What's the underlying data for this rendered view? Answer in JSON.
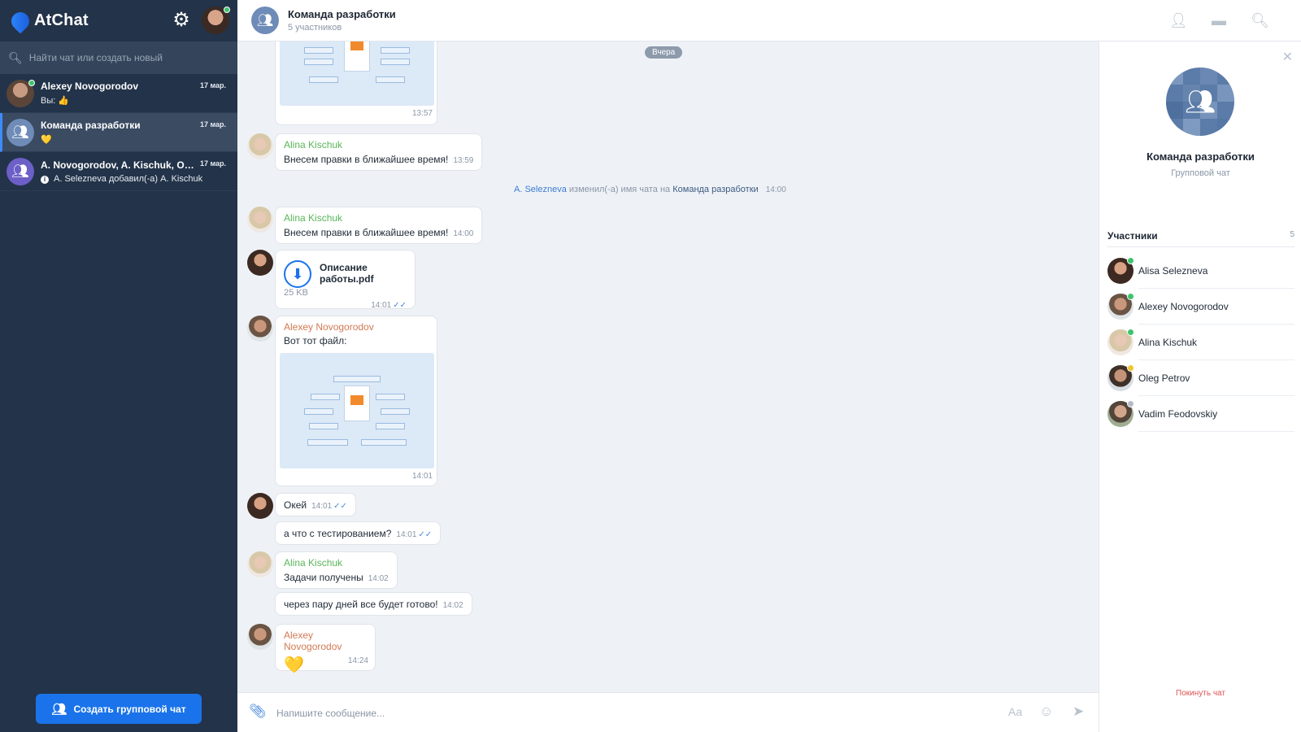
{
  "app": {
    "name": "AtChat",
    "accent": "#1a73ea",
    "sidebar_bg": "#233349"
  },
  "sidebar": {
    "search_placeholder": "Найти чат или создать новый",
    "chats": [
      {
        "name": "Alexey Novogorodov",
        "date": "17 мар.",
        "preview": "Вы: 👍",
        "online": true
      },
      {
        "name": "Команда разработки",
        "date": "17 мар.",
        "preview": "💛",
        "active": true
      },
      {
        "name": "A. Novogorodov, A. Kischuk, O. Petr...",
        "date": "17 мар.",
        "preview": "A. Selezneva  добавил(-а) A. Kischuk"
      }
    ],
    "create_group_label": "Создать групповой чат"
  },
  "header": {
    "title": "Команда разработки",
    "subtitle": "5 участников"
  },
  "messages": {
    "day_label": "Вчера",
    "m1": {
      "time": "13:57"
    },
    "m2": {
      "sender": "Alina Kischuk",
      "text": "Внесем правки в ближайшее время!",
      "time": "13:59"
    },
    "system": {
      "user": "A. Selezneva",
      "action": "изменил(-а) имя чата на",
      "chat": "Команда разработки",
      "time": "14:00"
    },
    "m3": {
      "sender": "Alina Kischuk",
      "text": "Внесем правки в ближайшее время!",
      "time": "14:00"
    },
    "m4": {
      "file_name": "Описание работы.pdf",
      "file_size": "25 KB",
      "time": "14:01"
    },
    "m5": {
      "sender": "Alexey Novogorodov",
      "text": "Вот тот файл:",
      "time": "14:01"
    },
    "m6": {
      "text": "Окей",
      "time": "14:01"
    },
    "m7": {
      "text": "а что с тестированием?",
      "time": "14:01"
    },
    "m8": {
      "sender": "Alina Kischuk",
      "text": "Задачи получены",
      "time": "14:02"
    },
    "m9": {
      "text": "через пару дней все будет готово!",
      "time": "14:02"
    },
    "m10": {
      "sender": "Alexey Novogorodov",
      "emoji": "💛",
      "time": "14:24"
    }
  },
  "composer": {
    "placeholder": "Напишите сообщение...",
    "format_label": "Aa"
  },
  "right_panel": {
    "title": "Команда разработки",
    "type": "Групповой чат",
    "members_title": "Участники",
    "members_count": "5",
    "members": [
      {
        "name": "Alisa Selezneva",
        "status_color": "#3cc46b"
      },
      {
        "name": "Alexey Novogorodov",
        "status_color": "#3cc46b"
      },
      {
        "name": "Alina Kischuk",
        "status_color": "#3cc46b"
      },
      {
        "name": "Oleg Petrov",
        "status_color": "#f2c230"
      },
      {
        "name": "Vadim Feodovskiy",
        "status_color": "#b5bcc6"
      }
    ],
    "leave_label": "Покинуть чат"
  }
}
